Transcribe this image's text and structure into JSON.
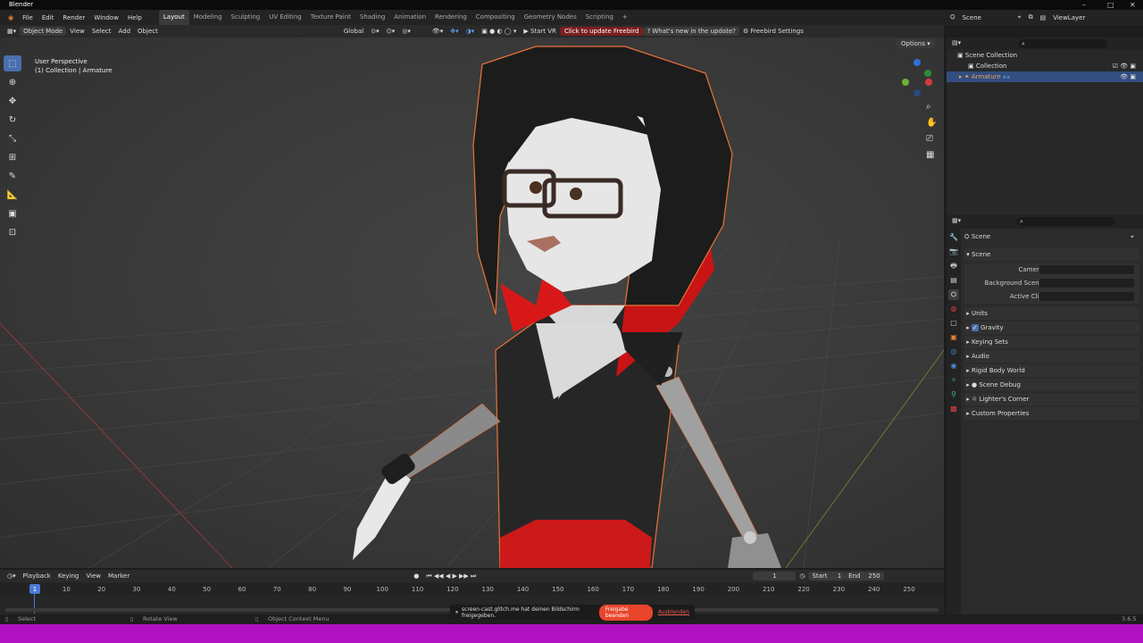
{
  "window": {
    "title": "Blender"
  },
  "menu": {
    "items": [
      "File",
      "Edit",
      "Render",
      "Window",
      "Help"
    ],
    "workspaces": [
      "Layout",
      "Modeling",
      "Sculpting",
      "UV Editing",
      "Texture Paint",
      "Shading",
      "Animation",
      "Rendering",
      "Compositing",
      "Geometry Nodes",
      "Scripting"
    ],
    "active_workspace": "Layout",
    "add_tab": "+"
  },
  "top_right": {
    "scene": "Scene",
    "view_layer": "ViewLayer"
  },
  "viewport_header": {
    "mode": "Object Mode",
    "menus": [
      "View",
      "Select",
      "Add",
      "Object"
    ],
    "orientation": "Global",
    "start_vr": "Start VR",
    "freebird_update": "Click to update Freebird",
    "whats_new": "What's new in the update?",
    "freebird_settings": "Freebird Settings",
    "options": "Options"
  },
  "viewport": {
    "perspective": "User Perspective",
    "collection": "(1) Collection | Armature"
  },
  "outliner": {
    "root": "Scene Collection",
    "collection": "Collection",
    "armature": "Armature"
  },
  "properties": {
    "header": "Scene",
    "panel": "Scene",
    "fields": [
      {
        "label": "Camera"
      },
      {
        "label": "Background Scene"
      },
      {
        "label": "Active Clip"
      }
    ],
    "sections": [
      "Units",
      "Gravity",
      "Keying Sets",
      "Audio",
      "Rigid Body World",
      "Scene Debug",
      "Lighter's Corner",
      "Custom Properties"
    ],
    "gravity_checked": true
  },
  "timeline": {
    "menus": [
      "Playback",
      "Keying",
      "View",
      "Marker"
    ],
    "current_frame": "1",
    "start_label": "Start",
    "start": "1",
    "end_label": "End",
    "end": "250",
    "ruler": [
      "1",
      "10",
      "20",
      "30",
      "40",
      "50",
      "60",
      "70",
      "80",
      "90",
      "100",
      "110",
      "120",
      "130",
      "140",
      "150",
      "160",
      "170",
      "180",
      "190",
      "200",
      "210",
      "220",
      "230",
      "240",
      "250"
    ]
  },
  "status": {
    "select": "Select",
    "rotate": "Rotate View",
    "context": "Object Context Menu",
    "version": "3.6.5"
  },
  "share_bar": {
    "message": "screen-cast.glitch.me hat deinen Bildschirm freigegeben.",
    "stop": "Freigabe beenden",
    "hide": "Ausblenden"
  },
  "colors": {
    "selection": "#4a6fb0",
    "outline": "#e8723a",
    "share_button": "#e8452c",
    "bottom_strip": "#b010c0"
  }
}
